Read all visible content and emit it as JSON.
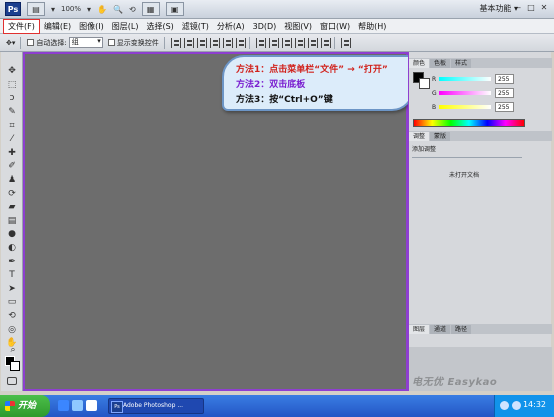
{
  "appbar": {
    "logo": "Ps",
    "zoom": "100%",
    "workspace": "基本功能 ▾",
    "icons": [
      "photoshop-logo",
      "bridge-icon",
      "minibridge-icon",
      "hand-tool-icon",
      "zoom-tool-icon",
      "rotate-view-icon",
      "arrange-docs-icon",
      "screen-mode-icon"
    ]
  },
  "window_controls": {
    "minimize": "–",
    "maximize": "□",
    "close": "✕"
  },
  "menubar": {
    "items": [
      "文件(F)",
      "编辑(E)",
      "图像(I)",
      "图层(L)",
      "选择(S)",
      "滤镜(T)",
      "分析(A)",
      "3D(D)",
      "视图(V)",
      "窗口(W)",
      "帮助(H)"
    ],
    "highlighted_index": 0,
    "highlight_color": "#e03030"
  },
  "optionsbar": {
    "auto_select_label": "自动选择:",
    "auto_select_value": "组",
    "show_transform_label": "显示变换控件"
  },
  "callout": {
    "line1": "方法1：点击菜单栏“文件” → “打开”",
    "line2": "方法2：双击底板",
    "line3": "方法3：按“Ctrl+O”键",
    "colors": {
      "line1": "#d1221c",
      "line2": "#7a1ed0",
      "line3": "#111111"
    }
  },
  "color_panel": {
    "tabs": [
      "颜色",
      "色板",
      "样式"
    ],
    "active_tab": 0,
    "channels": [
      {
        "label": "R",
        "value": "255"
      },
      {
        "label": "G",
        "value": "255"
      },
      {
        "label": "B",
        "value": "255"
      }
    ]
  },
  "adjust_panel": {
    "tabs": [
      "调整",
      "蒙版"
    ],
    "header": "添加调整",
    "empty_text": "未打开文档"
  },
  "layers_panel": {
    "tabs": [
      "图层",
      "通道",
      "路径"
    ]
  },
  "watermark": "电无优 Easykao",
  "taskbar": {
    "start_label": "开始",
    "task_label": "Adobe Photoshop ...",
    "clock": "14:32"
  },
  "accent_colors": {
    "canvas_border": "#8e3fd0",
    "canvas_bg": "#6d6d6d",
    "taskbar": "#2456c5"
  }
}
